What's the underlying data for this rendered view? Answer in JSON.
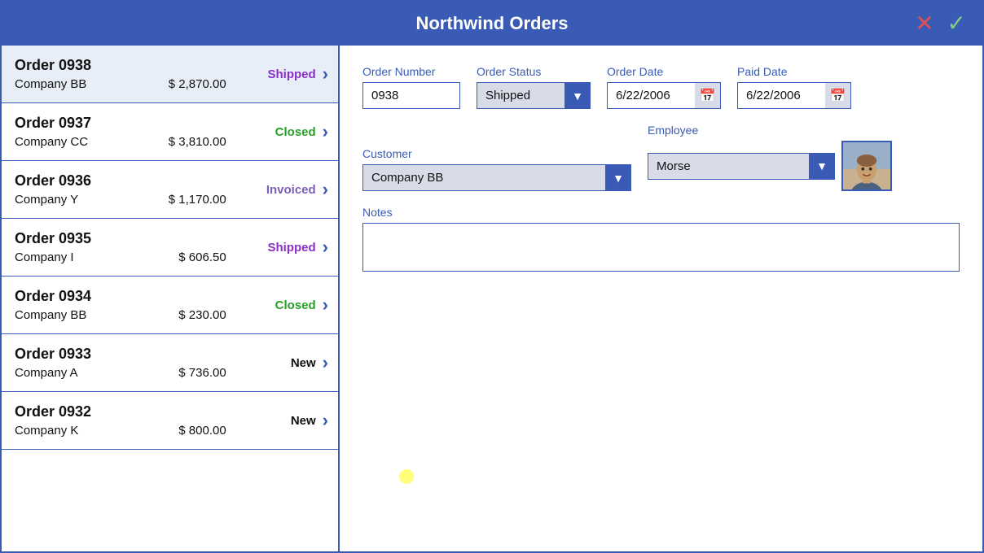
{
  "app": {
    "title": "Northwind Orders"
  },
  "actions": {
    "close_label": "✕",
    "confirm_label": "✓"
  },
  "orders": [
    {
      "id": "order-0938",
      "number": "Order 0938",
      "status": "Shipped",
      "status_class": "status-shipped",
      "company": "Company BB",
      "amount": "$ 2,870.00",
      "selected": true
    },
    {
      "id": "order-0937",
      "number": "Order 0937",
      "status": "Closed",
      "status_class": "status-closed",
      "company": "Company CC",
      "amount": "$ 3,810.00",
      "selected": false
    },
    {
      "id": "order-0936",
      "number": "Order 0936",
      "status": "Invoiced",
      "status_class": "status-invoiced",
      "company": "Company Y",
      "amount": "$ 1,170.00",
      "selected": false
    },
    {
      "id": "order-0935",
      "number": "Order 0935",
      "status": "Shipped",
      "status_class": "status-shipped",
      "company": "Company I",
      "amount": "$ 606.50",
      "selected": false
    },
    {
      "id": "order-0934",
      "number": "Order 0934",
      "status": "Closed",
      "status_class": "status-closed",
      "company": "Company BB",
      "amount": "$ 230.00",
      "selected": false
    },
    {
      "id": "order-0933",
      "number": "Order 0933",
      "status": "New",
      "status_class": "status-new",
      "company": "Company A",
      "amount": "$ 736.00",
      "selected": false
    },
    {
      "id": "order-0932",
      "number": "Order 0932",
      "status": "New",
      "status_class": "status-new",
      "company": "Company K",
      "amount": "$ 800.00",
      "selected": false
    }
  ],
  "detail": {
    "order_number_label": "Order Number",
    "order_number_value": "0938",
    "order_status_label": "Order Status",
    "order_status_value": "Shipped",
    "order_date_label": "Order Date",
    "order_date_value": "6/22/2006",
    "paid_date_label": "Paid Date",
    "paid_date_value": "6/22/2006",
    "customer_label": "Customer",
    "customer_value": "Company BB",
    "employee_label": "Employee",
    "employee_value": "Morse",
    "notes_label": "Notes",
    "notes_value": "",
    "notes_placeholder": ""
  },
  "status_options": [
    "New",
    "Invoiced",
    "Shipped",
    "Closed"
  ],
  "customer_options": [
    "Company A",
    "Company BB",
    "Company CC",
    "Company I",
    "Company K",
    "Company Y"
  ],
  "employee_options": [
    "Morse"
  ]
}
